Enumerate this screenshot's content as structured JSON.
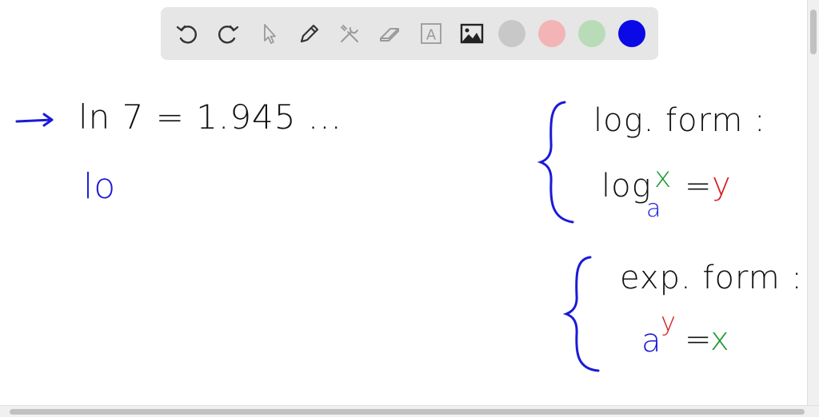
{
  "toolbar": {
    "tools": [
      {
        "name": "undo",
        "icon": "undo-icon"
      },
      {
        "name": "redo",
        "icon": "redo-icon"
      },
      {
        "name": "select",
        "icon": "cursor-icon"
      },
      {
        "name": "pen",
        "icon": "pencil-icon"
      },
      {
        "name": "tools",
        "icon": "wrench-icon"
      },
      {
        "name": "eraser",
        "icon": "eraser-icon"
      },
      {
        "name": "text",
        "icon": "text-box-icon",
        "glyph": "A"
      },
      {
        "name": "image",
        "icon": "image-icon"
      }
    ],
    "colors": [
      "#c8c8c8",
      "#f2b4b4",
      "#b8dcb8",
      "#0a0ae6"
    ],
    "selected_color": "#0a0ae6"
  },
  "board": {
    "line1": "ln 7 = 1.945 ...",
    "line2": "lo",
    "log_form": {
      "title": "log. form :",
      "log_text": "log",
      "base": "a",
      "arg": "x",
      "equals": "=",
      "result": "y"
    },
    "exp_form": {
      "title": "exp. form :",
      "base": "a",
      "exponent": "y",
      "equals": "=",
      "result": "x"
    }
  },
  "colors": {
    "black_ink": "#111111",
    "blue_ink": "#1a1ad8",
    "green_ink": "#1e9a2e",
    "red_ink": "#d42020"
  }
}
